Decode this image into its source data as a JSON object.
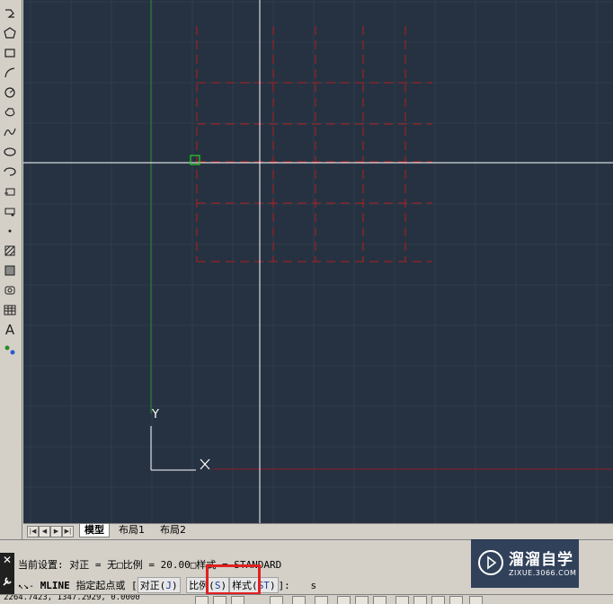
{
  "left_toolbar": {
    "icons": [
      "polyline-icon",
      "polygon-icon",
      "rectangle-icon",
      "arc-icon",
      "circle-icon",
      "revision-cloud-icon",
      "spline-icon",
      "ellipse-icon",
      "ellipse-arc-icon",
      "insert-block-icon",
      "make-block-icon",
      "point-icon",
      "hatch-icon",
      "gradient-icon",
      "region-icon",
      "table-icon",
      "multiline-text-icon",
      "add-selected-icon"
    ],
    "text_glyph": "A"
  },
  "canvas": {
    "background": "#263241",
    "grid_color": "#2f3c4c",
    "crosshair_color": "#ffffff",
    "multiline_color": "#b01e1e",
    "ucs_y_label": "Y",
    "ucs_x_label": "X"
  },
  "tabs": {
    "nav_buttons": [
      "|◀",
      "◀",
      "▶",
      "▶|"
    ],
    "items": [
      {
        "label": "模型",
        "active": true
      },
      {
        "label": "布局1",
        "active": false
      },
      {
        "label": "布局2",
        "active": false
      }
    ]
  },
  "command": {
    "close_glyph": "✕",
    "line1": "当前设置: 对正 = 无□比例 = 20.00□样式 = STANDARD",
    "prompt_icon": "↖↘-",
    "command_name": "MLINE",
    "prompt_text": "指定起点或 [",
    "opt1_label": "对正(",
    "opt1_key": "J",
    "opt1_close": ")",
    "opt2_label": "比例(",
    "opt2_key": "S",
    "opt2_close": ")",
    "opt3_label": "样式(",
    "opt3_key": "ST",
    "opt3_close": ")",
    "prompt_end": "]:",
    "input_value": "s",
    "highlight_color": "#e02020"
  },
  "watermark": {
    "title": "溜溜自学",
    "url": "ZIXUE.3066.COM"
  },
  "status_bar": {
    "coords": "2264.7423, 1347.2929, 0.0000"
  }
}
